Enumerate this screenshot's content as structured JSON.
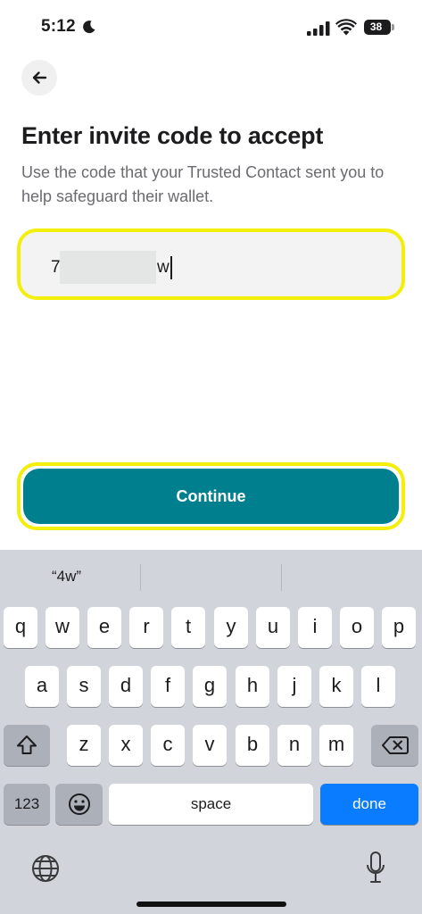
{
  "status_bar": {
    "time": "5:12",
    "battery_level": "38",
    "icons": [
      "moon-icon",
      "signal-icon",
      "wifi-icon",
      "battery-icon"
    ]
  },
  "header": {
    "back_icon": "arrow-left-icon"
  },
  "content": {
    "title": "Enter invite code to accept",
    "subtitle": "Use the code that your Trusted Contact sent you to help safeguard their wallet.",
    "code_input": {
      "visible_prefix": "7",
      "visible_suffix": "w",
      "redacted": true
    },
    "continue_label": "Continue"
  },
  "colors": {
    "accent": "#00808f",
    "highlight": "#f4ee0b",
    "field_bg": "#f3f3f3",
    "done_key": "#0a7cff"
  },
  "keyboard": {
    "suggestions": [
      "“4w”",
      "",
      ""
    ],
    "row1": [
      "q",
      "w",
      "e",
      "r",
      "t",
      "y",
      "u",
      "i",
      "o",
      "p"
    ],
    "row2": [
      "a",
      "s",
      "d",
      "f",
      "g",
      "h",
      "j",
      "k",
      "l"
    ],
    "row3": [
      "z",
      "x",
      "c",
      "v",
      "b",
      "n",
      "m"
    ],
    "numbers_label": "123",
    "space_label": "space",
    "done_label": "done",
    "icons": [
      "shift-icon",
      "backspace-icon",
      "emoji-icon",
      "globe-icon",
      "microphone-icon"
    ]
  }
}
